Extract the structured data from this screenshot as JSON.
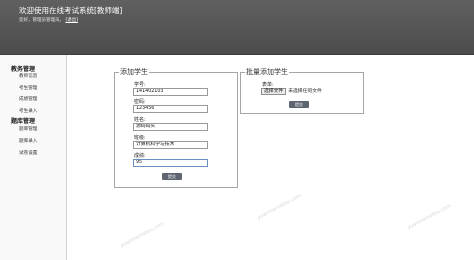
{
  "header": {
    "title": "欢迎使用在线考试系统[教师端]",
    "welcome": "您好，管理员管理员。",
    "logout": "[退出]"
  },
  "sidebar": {
    "groups": [
      {
        "title": "教务管理",
        "items": [
          "教师信息",
          "考生管理",
          "成绩管理",
          "考生录入"
        ]
      },
      {
        "title": "题库管理",
        "items": [
          "题库管理",
          "题库录入",
          "试卷设置"
        ]
      }
    ]
  },
  "add_student": {
    "legend": "添加学生",
    "fields": [
      {
        "label": "学号:",
        "value": "141402103"
      },
      {
        "label": "密码:",
        "value": "123456"
      },
      {
        "label": "姓名:",
        "value": "源码码头"
      },
      {
        "label": "班级:",
        "value": "计算机科学与技术"
      },
      {
        "label": "成绩:",
        "value": "95"
      }
    ],
    "submit": "提交"
  },
  "batch_add": {
    "legend": "批量添加学生",
    "file_label": "表单:",
    "choose_file": "选择文件",
    "no_file": "未选择任何文件",
    "submit": "提交"
  },
  "watermarks": [
    "yuanmamatou.com",
    "yuanmamatou.com",
    "yuanmamatou.com"
  ]
}
